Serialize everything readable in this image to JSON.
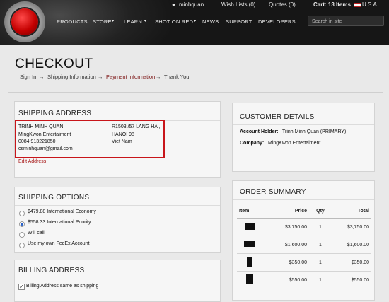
{
  "header": {
    "user": "minhquan",
    "wishlists": "Wish Lists (0)",
    "quotes": "Quotes (0)",
    "cart": "Cart: 13 Items",
    "locale": "U.S.A",
    "nav": [
      "PRODUCTS",
      "STORE",
      "LEARN",
      "SHOT ON RED",
      "NEWS",
      "SUPPORT",
      "DEVELOPERS"
    ],
    "search_placeholder": "Search in site"
  },
  "page": {
    "title": "CHECKOUT",
    "breadcrumbs": [
      "Sign In",
      "Shipping Information",
      "Payment Information",
      "Thank You"
    ],
    "arrow": "→"
  },
  "shipping": {
    "title": "SHIPPING ADDRESS",
    "name": "TRINH MINH QUAN",
    "company": "MingKwon Entertaiment",
    "phone": "0084 913221850",
    "email": "csminhquan@gmail.com",
    "addr1": "R1503 /57 LANG HA ,",
    "addr2": "HANOI 98",
    "country": "Viet Nam",
    "edit": "Edit Address"
  },
  "options": {
    "title": "SHIPPING OPTIONS",
    "items": [
      "$479.88 International Economy",
      "$558.33 International Priority",
      "Will call",
      "Use my own FedEx Account"
    ],
    "selected_index": 1
  },
  "billing": {
    "title": "BILLING ADDRESS",
    "same": "Billing Address same as shipping"
  },
  "customer": {
    "title": "CUSTOMER DETAILS",
    "holder_label": "Account Holder:",
    "holder": "Trinh Minh Quan (PRIMARY)",
    "company_label": "Company:",
    "company": "MingKwon Entertaiment"
  },
  "order": {
    "title": "ORDER SUMMARY",
    "headers": [
      "Item",
      "Price",
      "Qty",
      "Total"
    ],
    "rows": [
      {
        "price": "$3,750.00",
        "qty": "1",
        "total": "$3,750.00"
      },
      {
        "price": "$1,600.00",
        "qty": "1",
        "total": "$1,600.00"
      },
      {
        "price": "$350.00",
        "qty": "1",
        "total": "$350.00"
      },
      {
        "price": "$550.00",
        "qty": "1",
        "total": "$550.00"
      }
    ]
  },
  "colors": {
    "accent_red": "#c8151a",
    "link": "#a51414",
    "header_bg": "#161616"
  }
}
